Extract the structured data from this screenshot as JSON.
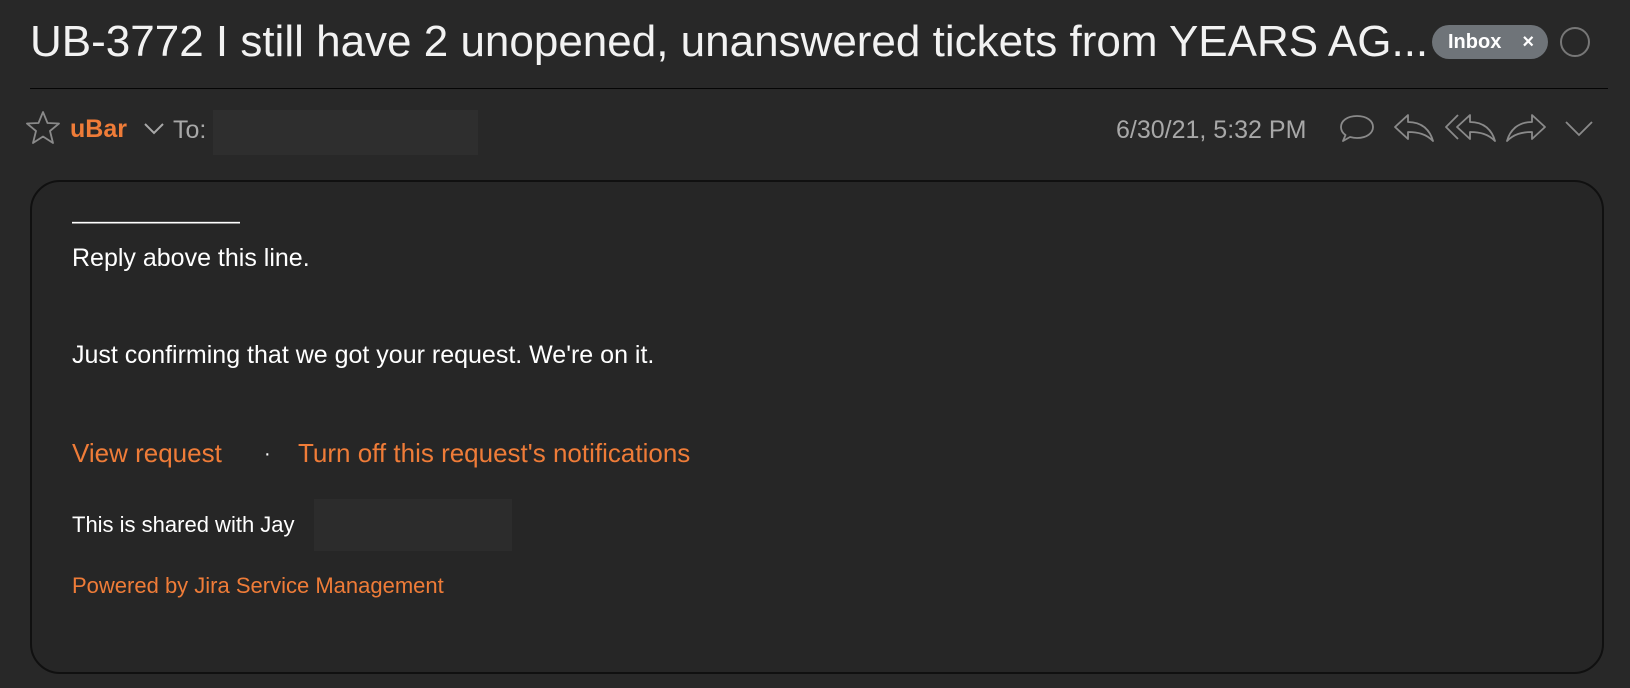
{
  "header": {
    "subject": "UB-3772 I still have 2 unopened, unanswered tickets from YEARS AG...",
    "badge_label": "Inbox",
    "badge_close": "×"
  },
  "meta": {
    "sender": "uBar",
    "to_label": "To:",
    "date": "6/30/21, 5:32 PM"
  },
  "icons": {
    "star": "star-icon",
    "sender_menu": "chevron-down-icon",
    "comment": "comment-icon",
    "reply": "reply-icon",
    "reply_all": "reply-all-icon",
    "forward": "forward-icon",
    "more": "chevron-down-icon"
  },
  "email": {
    "rule": "———————",
    "reply_above": "Reply above this line.",
    "confirm": "Just confirming that we got your request. We're on it.",
    "view_request": "View request",
    "separator": "·",
    "turn_off": "Turn off this request's notifications",
    "shared_with": "This is shared with Jay",
    "powered_by": "Powered by Jira Service Management"
  },
  "colors": {
    "accent": "#ef7c38",
    "background": "#282828",
    "badge": "#6f7479"
  }
}
